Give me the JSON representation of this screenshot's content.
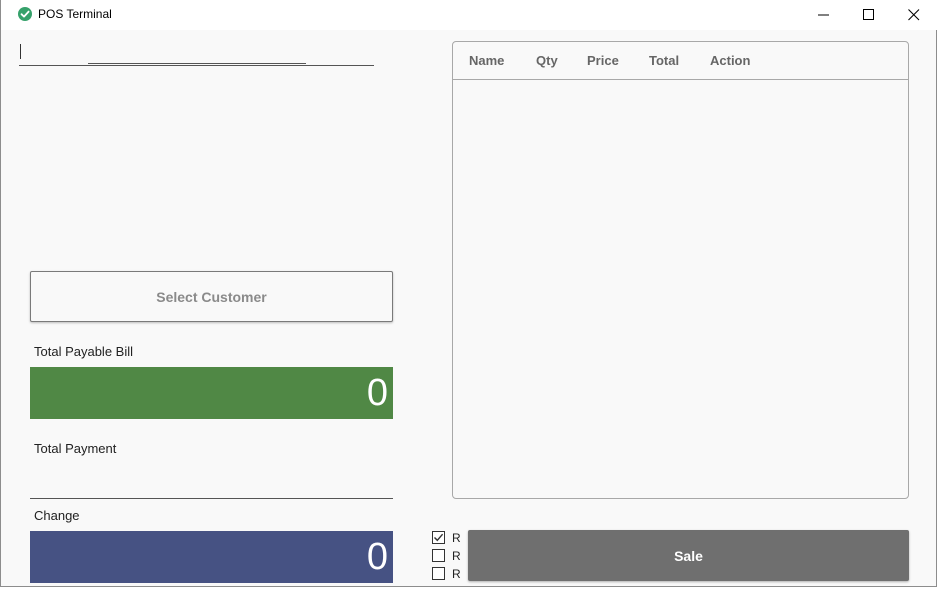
{
  "window": {
    "title": "POS Terminal",
    "app_icon": "checkmark-circle-icon"
  },
  "search": {
    "value": "",
    "placeholder": ""
  },
  "customer": {
    "select_label": "Select Customer"
  },
  "totals": {
    "payable_label": "Total Payable Bill",
    "payable_value": "0",
    "payment_label": "Total Payment",
    "payment_value": "",
    "change_label": "Change",
    "change_value": "0"
  },
  "grid": {
    "columns": [
      "Name",
      "Qty",
      "Price",
      "Total",
      "Action"
    ],
    "rows": []
  },
  "options": [
    {
      "label": "R",
      "checked": true
    },
    {
      "label": "R",
      "checked": false
    },
    {
      "label": "R",
      "checked": false
    }
  ],
  "actions": {
    "sale_label": "Sale"
  },
  "colors": {
    "payable_bg": "#508845",
    "change_bg": "#465283",
    "sale_bg": "#6f6f6f",
    "app_icon": "#36a16b"
  }
}
